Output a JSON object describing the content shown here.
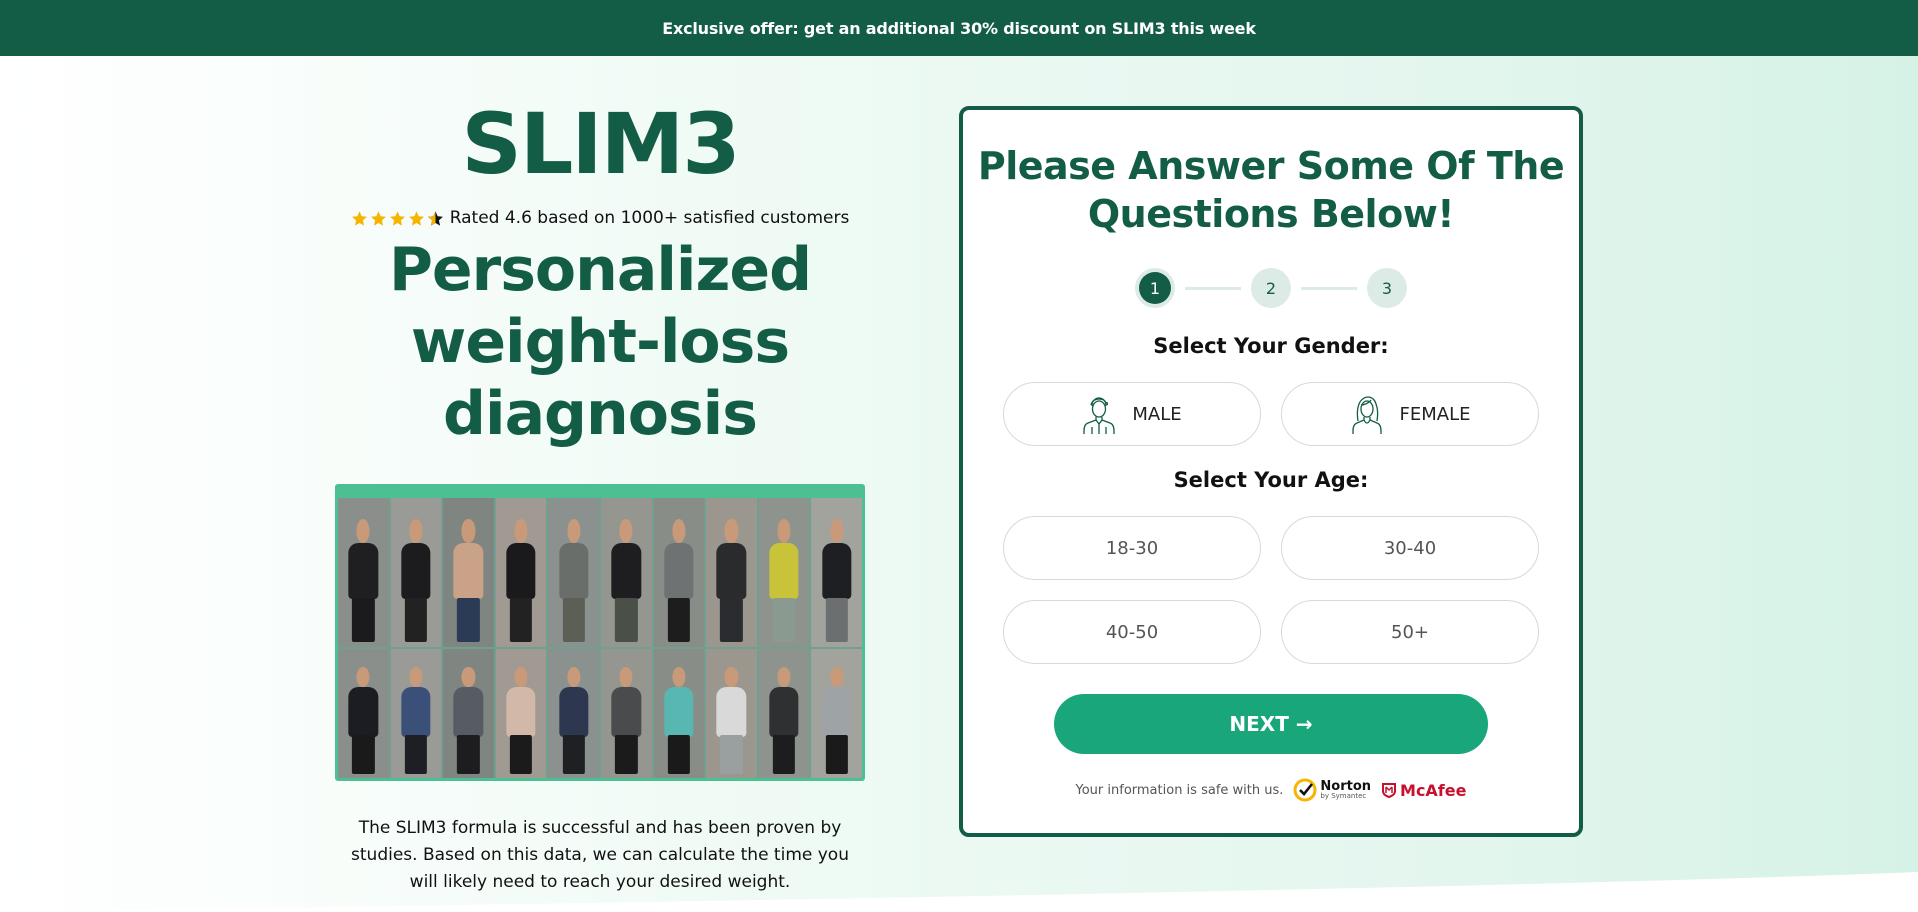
{
  "banner": {
    "text": "Exclusive offer: get an additional 30% discount on SLIM3 this week"
  },
  "hero": {
    "brand": "SLIM3",
    "rating_value": 4.6,
    "rating_max": 5,
    "rating_text": "Rated 4.6 based on 1000+ satisfied customers",
    "headline": "Personalized weight-loss diagnosis",
    "description": "The SLIM3 formula is successful and has been proven by studies. Based on this data, we can calculate the time you will likely need to reach your desired weight."
  },
  "colors": {
    "brand_dark": "#135c45",
    "accent": "#19a67a",
    "star": "#f5b400",
    "mcafee": "#c8102e",
    "norton": "#f7b500"
  },
  "quiz": {
    "title": "Please Answer Some Of The Questions Below!",
    "steps": [
      "1",
      "2",
      "3"
    ],
    "current_step": 1,
    "gender_label": "Select Your Gender:",
    "gender_options": [
      {
        "label": "MALE",
        "icon": "male-avatar-icon"
      },
      {
        "label": "FEMALE",
        "icon": "female-avatar-icon"
      }
    ],
    "age_label": "Select Your Age:",
    "age_options": [
      "18-30",
      "30-40",
      "40-50",
      "50+"
    ],
    "next_label": "NEXT →",
    "safe_text": "Your information is safe with us.",
    "badges": {
      "norton": "Norton",
      "norton_sub": "by Symantec",
      "mcafee": "McAfee"
    }
  }
}
